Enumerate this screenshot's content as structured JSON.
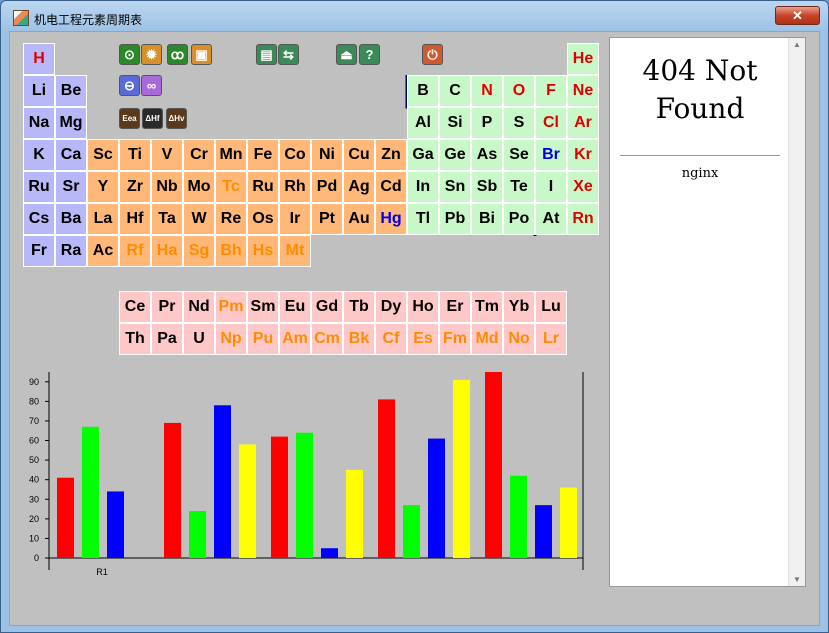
{
  "window": {
    "title": "机电工程元素周期表",
    "close_label": "✕"
  },
  "toolbar": {
    "buttons": [
      {
        "icon": "atom-icon",
        "glyph": "⊙",
        "color": "#2a8a2a"
      },
      {
        "icon": "gear-icon",
        "glyph": "✹",
        "color": "#d8902a"
      },
      {
        "icon": "molecule-icon",
        "glyph": "ꝏ",
        "color": "#2a8a2a"
      },
      {
        "icon": "square-icon",
        "glyph": "▣",
        "color": "#d8902a"
      },
      {
        "icon": "chart-icon",
        "glyph": "▤",
        "color": "#3a8a5a"
      },
      {
        "icon": "swap-icon",
        "glyph": "⇆",
        "color": "#3a8a5a"
      },
      {
        "icon": "eject-icon",
        "glyph": "⏏",
        "color": "#3a8a5a"
      },
      {
        "icon": "help-icon",
        "glyph": "?",
        "color": "#3a8a5a"
      },
      {
        "icon": "power-icon",
        "glyph": "⏻",
        "color": "#d05a30"
      },
      {
        "icon": "link-icon",
        "glyph": "⊖",
        "color": "#5a6ad8"
      },
      {
        "icon": "chain-icon",
        "glyph": "∞",
        "color": "#a86ad8"
      },
      {
        "icon": "eea-icon",
        "glyph": "Eea",
        "color": "#5a3a1a"
      },
      {
        "icon": "delta-hf-icon",
        "glyph": "ΔHf",
        "color": "#2a2a2a"
      },
      {
        "icon": "delta-hv-icon",
        "glyph": "ΔHv",
        "color": "#5a3a1a"
      }
    ]
  },
  "colors": {
    "s_block": "#b8b8f8",
    "d_block": "#ffb878",
    "p_block": "#c8f8c8",
    "f_block": "#ffc8c8",
    "red": "#e00000",
    "orange": "#ff8c00",
    "blue": "#0000e0",
    "black": "#000000"
  },
  "elements": [
    {
      "s": "H",
      "g": 1,
      "r": 1,
      "b": "s",
      "c": "red"
    },
    {
      "s": "He",
      "g": 18,
      "r": 1,
      "b": "p",
      "c": "red"
    },
    {
      "s": "Li",
      "g": 1,
      "r": 2,
      "b": "s",
      "c": "black"
    },
    {
      "s": "Be",
      "g": 2,
      "r": 2,
      "b": "s",
      "c": "black"
    },
    {
      "s": "B",
      "g": 13,
      "r": 2,
      "b": "p",
      "c": "black"
    },
    {
      "s": "C",
      "g": 14,
      "r": 2,
      "b": "p",
      "c": "black"
    },
    {
      "s": "N",
      "g": 15,
      "r": 2,
      "b": "p",
      "c": "red"
    },
    {
      "s": "O",
      "g": 16,
      "r": 2,
      "b": "p",
      "c": "red"
    },
    {
      "s": "F",
      "g": 17,
      "r": 2,
      "b": "p",
      "c": "red"
    },
    {
      "s": "Ne",
      "g": 18,
      "r": 2,
      "b": "p",
      "c": "red"
    },
    {
      "s": "Na",
      "g": 1,
      "r": 3,
      "b": "s",
      "c": "black"
    },
    {
      "s": "Mg",
      "g": 2,
      "r": 3,
      "b": "s",
      "c": "black"
    },
    {
      "s": "Al",
      "g": 13,
      "r": 3,
      "b": "p",
      "c": "black"
    },
    {
      "s": "Si",
      "g": 14,
      "r": 3,
      "b": "p",
      "c": "black"
    },
    {
      "s": "P",
      "g": 15,
      "r": 3,
      "b": "p",
      "c": "black"
    },
    {
      "s": "S",
      "g": 16,
      "r": 3,
      "b": "p",
      "c": "black"
    },
    {
      "s": "Cl",
      "g": 17,
      "r": 3,
      "b": "p",
      "c": "red"
    },
    {
      "s": "Ar",
      "g": 18,
      "r": 3,
      "b": "p",
      "c": "red"
    },
    {
      "s": "K",
      "g": 1,
      "r": 4,
      "b": "s",
      "c": "black"
    },
    {
      "s": "Ca",
      "g": 2,
      "r": 4,
      "b": "s",
      "c": "black"
    },
    {
      "s": "Sc",
      "g": 3,
      "r": 4,
      "b": "d",
      "c": "black"
    },
    {
      "s": "Ti",
      "g": 4,
      "r": 4,
      "b": "d",
      "c": "black"
    },
    {
      "s": "V",
      "g": 5,
      "r": 4,
      "b": "d",
      "c": "black"
    },
    {
      "s": "Cr",
      "g": 6,
      "r": 4,
      "b": "d",
      "c": "black"
    },
    {
      "s": "Mn",
      "g": 7,
      "r": 4,
      "b": "d",
      "c": "black"
    },
    {
      "s": "Fe",
      "g": 8,
      "r": 4,
      "b": "d",
      "c": "black"
    },
    {
      "s": "Co",
      "g": 9,
      "r": 4,
      "b": "d",
      "c": "black"
    },
    {
      "s": "Ni",
      "g": 10,
      "r": 4,
      "b": "d",
      "c": "black"
    },
    {
      "s": "Cu",
      "g": 11,
      "r": 4,
      "b": "d",
      "c": "black"
    },
    {
      "s": "Zn",
      "g": 12,
      "r": 4,
      "b": "d",
      "c": "black"
    },
    {
      "s": "Ga",
      "g": 13,
      "r": 4,
      "b": "p",
      "c": "black"
    },
    {
      "s": "Ge",
      "g": 14,
      "r": 4,
      "b": "p",
      "c": "black"
    },
    {
      "s": "As",
      "g": 15,
      "r": 4,
      "b": "p",
      "c": "black"
    },
    {
      "s": "Se",
      "g": 16,
      "r": 4,
      "b": "p",
      "c": "black"
    },
    {
      "s": "Br",
      "g": 17,
      "r": 4,
      "b": "p",
      "c": "blue"
    },
    {
      "s": "Kr",
      "g": 18,
      "r": 4,
      "b": "p",
      "c": "red"
    },
    {
      "s": "Ru",
      "g": 1,
      "r": 5,
      "b": "s",
      "c": "black"
    },
    {
      "s": "Sr",
      "g": 2,
      "r": 5,
      "b": "s",
      "c": "black"
    },
    {
      "s": "Y",
      "g": 3,
      "r": 5,
      "b": "d",
      "c": "black"
    },
    {
      "s": "Zr",
      "g": 4,
      "r": 5,
      "b": "d",
      "c": "black"
    },
    {
      "s": "Nb",
      "g": 5,
      "r": 5,
      "b": "d",
      "c": "black"
    },
    {
      "s": "Mo",
      "g": 6,
      "r": 5,
      "b": "d",
      "c": "black"
    },
    {
      "s": "Tc",
      "g": 7,
      "r": 5,
      "b": "d",
      "c": "orange"
    },
    {
      "s": "Ru",
      "g": 8,
      "r": 5,
      "b": "d",
      "c": "black"
    },
    {
      "s": "Rh",
      "g": 9,
      "r": 5,
      "b": "d",
      "c": "black"
    },
    {
      "s": "Pd",
      "g": 10,
      "r": 5,
      "b": "d",
      "c": "black"
    },
    {
      "s": "Ag",
      "g": 11,
      "r": 5,
      "b": "d",
      "c": "black"
    },
    {
      "s": "Cd",
      "g": 12,
      "r": 5,
      "b": "d",
      "c": "black"
    },
    {
      "s": "In",
      "g": 13,
      "r": 5,
      "b": "p",
      "c": "black"
    },
    {
      "s": "Sn",
      "g": 14,
      "r": 5,
      "b": "p",
      "c": "black"
    },
    {
      "s": "Sb",
      "g": 15,
      "r": 5,
      "b": "p",
      "c": "black"
    },
    {
      "s": "Te",
      "g": 16,
      "r": 5,
      "b": "p",
      "c": "black"
    },
    {
      "s": "I",
      "g": 17,
      "r": 5,
      "b": "p",
      "c": "black"
    },
    {
      "s": "Xe",
      "g": 18,
      "r": 5,
      "b": "p",
      "c": "red"
    },
    {
      "s": "Cs",
      "g": 1,
      "r": 6,
      "b": "s",
      "c": "black"
    },
    {
      "s": "Ba",
      "g": 2,
      "r": 6,
      "b": "s",
      "c": "black"
    },
    {
      "s": "La",
      "g": 3,
      "r": 6,
      "b": "d",
      "c": "black"
    },
    {
      "s": "Hf",
      "g": 4,
      "r": 6,
      "b": "d",
      "c": "black"
    },
    {
      "s": "Ta",
      "g": 5,
      "r": 6,
      "b": "d",
      "c": "black"
    },
    {
      "s": "W",
      "g": 6,
      "r": 6,
      "b": "d",
      "c": "black"
    },
    {
      "s": "Re",
      "g": 7,
      "r": 6,
      "b": "d",
      "c": "black"
    },
    {
      "s": "Os",
      "g": 8,
      "r": 6,
      "b": "d",
      "c": "black"
    },
    {
      "s": "Ir",
      "g": 9,
      "r": 6,
      "b": "d",
      "c": "black"
    },
    {
      "s": "Pt",
      "g": 10,
      "r": 6,
      "b": "d",
      "c": "black"
    },
    {
      "s": "Au",
      "g": 11,
      "r": 6,
      "b": "d",
      "c": "black"
    },
    {
      "s": "Hg",
      "g": 12,
      "r": 6,
      "b": "d",
      "c": "blue"
    },
    {
      "s": "Tl",
      "g": 13,
      "r": 6,
      "b": "p",
      "c": "black"
    },
    {
      "s": "Pb",
      "g": 14,
      "r": 6,
      "b": "p",
      "c": "black"
    },
    {
      "s": "Bi",
      "g": 15,
      "r": 6,
      "b": "p",
      "c": "black"
    },
    {
      "s": "Po",
      "g": 16,
      "r": 6,
      "b": "p",
      "c": "black"
    },
    {
      "s": "At",
      "g": 17,
      "r": 6,
      "b": "p",
      "c": "black"
    },
    {
      "s": "Rn",
      "g": 18,
      "r": 6,
      "b": "p",
      "c": "red"
    },
    {
      "s": "Fr",
      "g": 1,
      "r": 7,
      "b": "s",
      "c": "black"
    },
    {
      "s": "Ra",
      "g": 2,
      "r": 7,
      "b": "s",
      "c": "black"
    },
    {
      "s": "Ac",
      "g": 3,
      "r": 7,
      "b": "d",
      "c": "black"
    },
    {
      "s": "Rf",
      "g": 4,
      "r": 7,
      "b": "d",
      "c": "orange"
    },
    {
      "s": "Ha",
      "g": 5,
      "r": 7,
      "b": "d",
      "c": "orange"
    },
    {
      "s": "Sg",
      "g": 6,
      "r": 7,
      "b": "d",
      "c": "orange"
    },
    {
      "s": "Bh",
      "g": 7,
      "r": 7,
      "b": "d",
      "c": "orange"
    },
    {
      "s": "Hs",
      "g": 8,
      "r": 7,
      "b": "d",
      "c": "orange"
    },
    {
      "s": "Mt",
      "g": 9,
      "r": 7,
      "b": "d",
      "c": "orange"
    }
  ],
  "lanthanides": [
    {
      "s": "Ce",
      "c": "black"
    },
    {
      "s": "Pr",
      "c": "black"
    },
    {
      "s": "Nd",
      "c": "black"
    },
    {
      "s": "Pm",
      "c": "orange"
    },
    {
      "s": "Sm",
      "c": "black"
    },
    {
      "s": "Eu",
      "c": "black"
    },
    {
      "s": "Gd",
      "c": "black"
    },
    {
      "s": "Tb",
      "c": "black"
    },
    {
      "s": "Dy",
      "c": "black"
    },
    {
      "s": "Ho",
      "c": "black"
    },
    {
      "s": "Er",
      "c": "black"
    },
    {
      "s": "Tm",
      "c": "black"
    },
    {
      "s": "Yb",
      "c": "black"
    },
    {
      "s": "Lu",
      "c": "black"
    }
  ],
  "actinides": [
    {
      "s": "Th",
      "c": "black"
    },
    {
      "s": "Pa",
      "c": "black"
    },
    {
      "s": "U",
      "c": "black"
    },
    {
      "s": "Np",
      "c": "orange"
    },
    {
      "s": "Pu",
      "c": "orange"
    },
    {
      "s": "Am",
      "c": "orange"
    },
    {
      "s": "Cm",
      "c": "orange"
    },
    {
      "s": "Bk",
      "c": "orange"
    },
    {
      "s": "Cf",
      "c": "orange"
    },
    {
      "s": "Es",
      "c": "orange"
    },
    {
      "s": "Fm",
      "c": "orange"
    },
    {
      "s": "Md",
      "c": "orange"
    },
    {
      "s": "No",
      "c": "orange"
    },
    {
      "s": "Lr",
      "c": "orange"
    }
  ],
  "browser": {
    "title": "404 Not Found",
    "footer": "nginx",
    "scroll_up": "▲",
    "scroll_down": "▼"
  },
  "chart_data": {
    "type": "bar",
    "categories": [
      "R1"
    ],
    "ylim": [
      0,
      95
    ],
    "yticks": [
      0,
      10,
      20,
      30,
      40,
      50,
      60,
      70,
      80,
      90
    ],
    "bar_colors": [
      "#ff0000",
      "#00ff00",
      "#0000ff",
      "#ffff00"
    ],
    "groups": [
      {
        "values": [
          41,
          67,
          34,
          null
        ]
      },
      {
        "values": [
          69,
          24,
          78,
          58
        ]
      },
      {
        "values": [
          62,
          64,
          5,
          45
        ]
      },
      {
        "values": [
          81,
          27,
          61,
          91
        ]
      },
      {
        "values": [
          95,
          42,
          27,
          36
        ]
      }
    ]
  }
}
